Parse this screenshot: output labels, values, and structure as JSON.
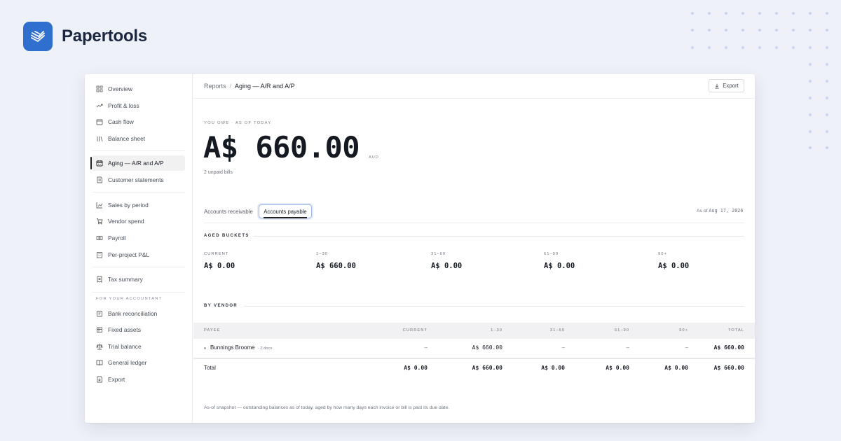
{
  "brand": {
    "name": "Papertools",
    "accent": "#2f6fce"
  },
  "sidebar": {
    "groups": [
      [
        {
          "label": "Overview",
          "icon": "grid-icon"
        },
        {
          "label": "Profit & loss",
          "icon": "trend-icon"
        },
        {
          "label": "Cash flow",
          "icon": "wallet-icon"
        },
        {
          "label": "Balance sheet",
          "icon": "columns-icon"
        }
      ],
      [
        {
          "label": "Aging — A/R and A/P",
          "icon": "calendar-icon",
          "active": true
        },
        {
          "label": "Customer statements",
          "icon": "document-icon"
        }
      ],
      [
        {
          "label": "Sales by period",
          "icon": "chart-icon"
        },
        {
          "label": "Vendor spend",
          "icon": "cart-icon"
        },
        {
          "label": "Payroll",
          "icon": "banknote-icon"
        },
        {
          "label": "Per-project P&L",
          "icon": "building-icon"
        }
      ],
      [
        {
          "label": "Tax summary",
          "icon": "receipt-icon"
        }
      ]
    ],
    "accountant_section": "FOR YOUR ACCOUNTANT",
    "accountant_items": [
      {
        "label": "Bank reconciliation",
        "icon": "bank-icon"
      },
      {
        "label": "Fixed assets",
        "icon": "layers-icon"
      },
      {
        "label": "Trial balance",
        "icon": "scale-icon"
      },
      {
        "label": "General ledger",
        "icon": "book-icon"
      },
      {
        "label": "Export",
        "icon": "export-icon"
      }
    ]
  },
  "topbar": {
    "breadcrumb_root": "Reports",
    "breadcrumb_separator": "/",
    "breadcrumb_current": "Aging — A/R and A/P",
    "export_label": "Export"
  },
  "summary": {
    "label": "YOU OWE · AS OF TODAY",
    "amount": "A$ 660.00",
    "currency": "AUD",
    "unpaid": "2 unpaid bills"
  },
  "tabs": {
    "receivable": "Accounts receivable",
    "payable": "Accounts payable",
    "active": "payable",
    "as_of_prefix": "As of",
    "as_of_date": "Aug 17, 2026"
  },
  "buckets": {
    "title": "AGED BUCKETS",
    "items": [
      {
        "label": "CURRENT",
        "value": "A$ 0.00"
      },
      {
        "label": "1–30",
        "value": "A$ 660.00"
      },
      {
        "label": "31–60",
        "value": "A$ 0.00"
      },
      {
        "label": "61–90",
        "value": "A$ 0.00"
      },
      {
        "label": "90+",
        "value": "A$ 0.00"
      }
    ]
  },
  "by_vendor": {
    "title": "BY VENDOR",
    "columns": [
      "PAYEE",
      "CURRENT",
      "1–30",
      "31–60",
      "61–90",
      "90+",
      "TOTAL"
    ],
    "rows": [
      {
        "payee": "Bunnings Broome",
        "docs": "· 2 docs",
        "cells": [
          "–",
          "A$ 660.00",
          "–",
          "–",
          "–",
          "A$ 660.00"
        ]
      }
    ],
    "total": {
      "label": "Total",
      "cells": [
        "A$ 0.00",
        "A$ 660.00",
        "A$ 0.00",
        "A$ 0.00",
        "A$ 0.00",
        "A$ 660.00"
      ]
    }
  },
  "footnote": "As-of snapshot — outstanding balances as of today, aged by how many days each invoice or bill is past its due date."
}
